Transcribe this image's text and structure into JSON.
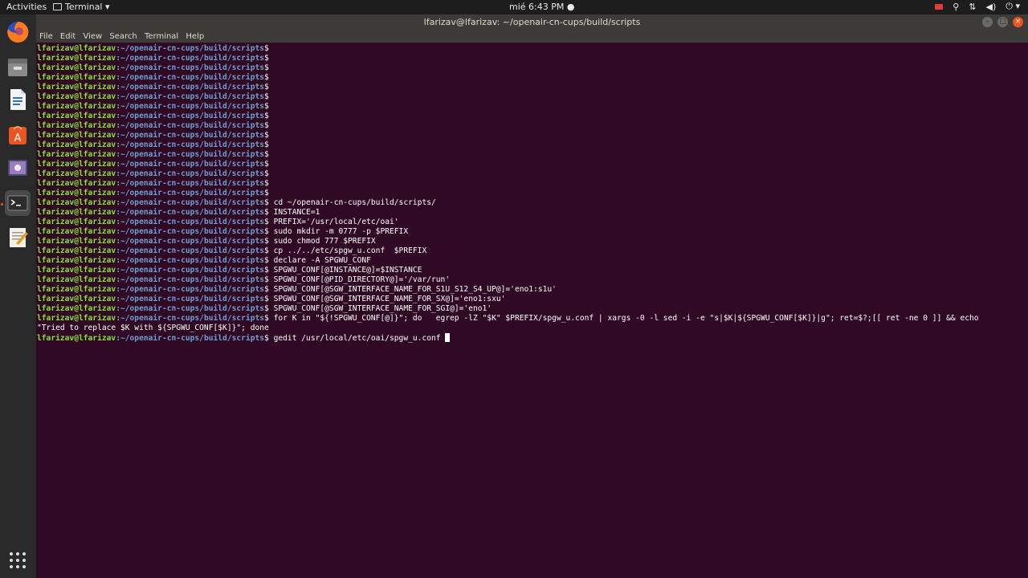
{
  "topbar": {
    "activities": "Activities",
    "app_name": "Terminal ▾",
    "clock": "mié  6:43 PM ●",
    "tray_icons": [
      "record-icon",
      "accessibility-icon",
      "network-icon",
      "volume-icon",
      "power-icon"
    ]
  },
  "window": {
    "title": "lfarizav@lfarizav: ~/openair-cn-cups/build/scripts"
  },
  "menubar": [
    "File",
    "Edit",
    "View",
    "Search",
    "Terminal",
    "Help"
  ],
  "terminal": {
    "prompt_user": "lfarizav@lfarizav",
    "prompt_path": ":~/openair-cn-cups/build/scripts",
    "prompt_end": "$ ",
    "empty_prompts": 16,
    "commands": [
      "cd ~/openair-cn-cups/build/scripts/",
      "INSTANCE=1",
      "PREFIX='/usr/local/etc/oai'",
      "sudo mkdir -m 0777 -p $PREFIX",
      "sudo chmod 777 $PREFIX",
      "cp ../../etc/spgw_u.conf  $PREFIX",
      "declare -A SPGWU_CONF",
      "SPGWU_CONF[@INSTANCE@]=$INSTANCE",
      "SPGWU_CONF[@PID_DIRECTORY@]='/var/run'",
      "SPGWU_CONF[@SGW_INTERFACE_NAME_FOR_S1U_S12_S4_UP@]='eno1:s1u'",
      "SPGWU_CONF[@SGW_INTERFACE_NAME_FOR_SX@]='eno1:sxu'",
      "SPGWU_CONF[@SGW_INTERFACE_NAME_FOR_SGI@]='eno1'",
      "for K in \"${!SPGWU_CONF[@]}\"; do   egrep -lZ \"$K\" $PREFIX/spgw_u.conf | xargs -0 -l sed -i -e \"s|$K|${SPGWU_CONF[$K]}|g\"; ret=$?;[[ ret -ne 0 ]] && echo"
    ],
    "wrapped_line": "\"Tried to replace $K with ${SPGWU_CONF[$K]}\"; done",
    "current_command": "gedit /usr/local/etc/oai/spgw_u.conf "
  },
  "colors": {
    "background": "#300a24",
    "prompt_user": "#8ae234",
    "prompt_path": "#729fcf"
  }
}
